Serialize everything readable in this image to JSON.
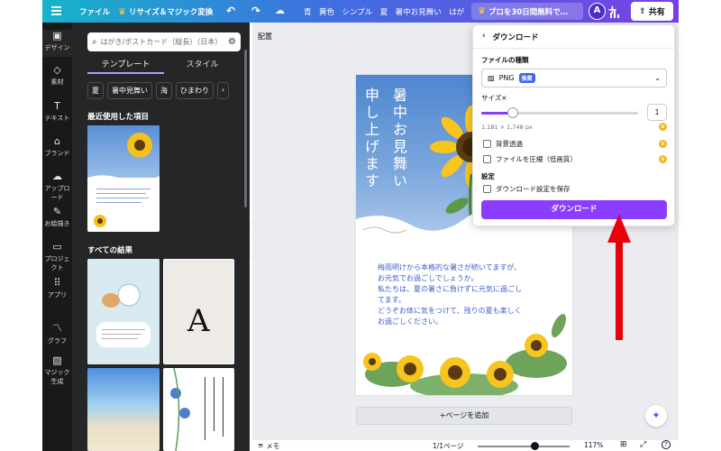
{
  "topbar": {
    "file": "ファイル",
    "resize": "リサイズ＆マジック変換",
    "doc_title": "青　黄色　シンプル　夏　暑中お見舞い　はがき…",
    "pro_button": "プロを30日間無料で…",
    "avatar": "A",
    "share": "共有"
  },
  "rail": {
    "items": [
      "デザイン",
      "素材",
      "テキスト",
      "ブランド",
      "アップロード",
      "お絵描き",
      "プロジェクト",
      "アプリ",
      "グラフ",
      "マジック生成"
    ]
  },
  "panel": {
    "search_placeholder": "はがき/ポストカード（縦長）（日本）",
    "tabs": [
      "テンプレート",
      "スタイル"
    ],
    "chips": [
      "夏",
      "暑中見舞い",
      "海",
      "ひまわり"
    ],
    "recent_title": "最近使用した項目",
    "all_results_title": "すべての結果",
    "template_text": "A"
  },
  "canvas": {
    "arrange": "配置",
    "title_col1": "暑中お見舞い",
    "title_col2": "申し上げます",
    "body_lines": [
      "梅雨明けから本格的な暑さが続いてますが、",
      "お元気でお過ごしでしょうか。",
      "私たちは、夏の暑さに負けずに元気に過ごし",
      "てます。",
      "どうぞお体に気をつけて、残りの夏も楽しく",
      "お過ごしください。"
    ],
    "add_page": "+ページを追加"
  },
  "bottombar": {
    "notes": "メモ",
    "page_indicator": "1/1ページ",
    "zoom": "117%",
    "zoom_fraction": 0.62
  },
  "download": {
    "title": "ダウンロード",
    "file_type_label": "ファイルの種類",
    "file_type": "PNG",
    "recommended_badge": "推奨",
    "size_label": "サイズ×",
    "size_value": "1",
    "size_fraction": 0.2,
    "size_px": "1,181 × 1,748 px",
    "options": [
      "背景透過",
      "ファイルを圧縮（低画質）"
    ],
    "settings_label": "設定",
    "save_settings": "ダウンロード設定を保存",
    "button": "ダウンロード"
  },
  "colors": {
    "brand_purple": "#8b3dff",
    "rail_bg": "#18191b",
    "panel_bg": "#252627",
    "canvas_bg": "#ebecf0",
    "annotation_red": "#e8000b"
  }
}
